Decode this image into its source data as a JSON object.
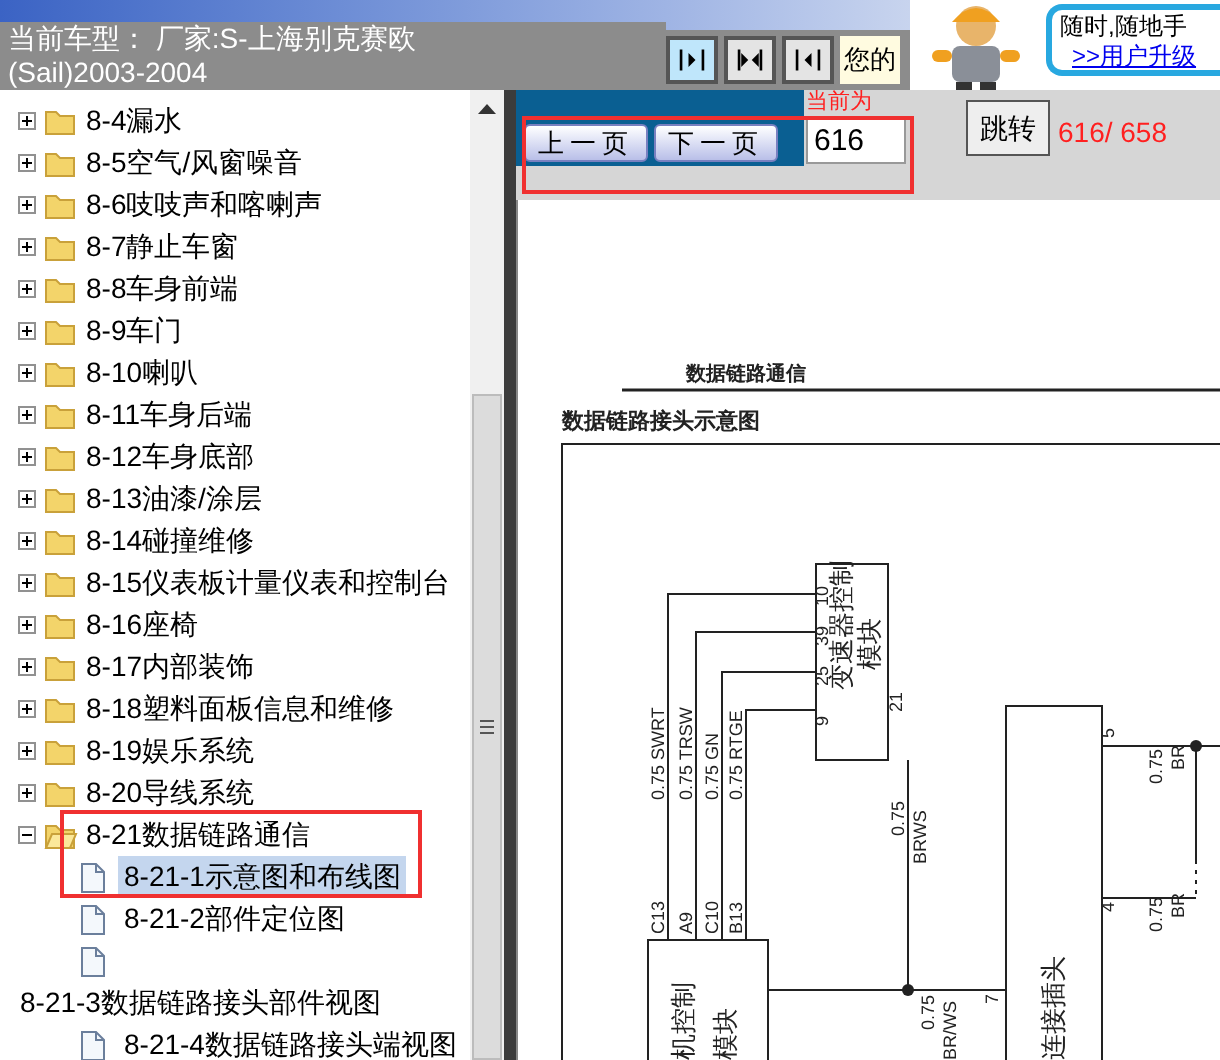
{
  "header": {
    "vehicle": "当前车型：  厂家:S-上海别克赛欧(Sail)2003-2004",
    "view_buttons": [
      {
        "kind": "right",
        "selected": true
      },
      {
        "kind": "both",
        "selected": false
      },
      {
        "kind": "left",
        "selected": false
      }
    ],
    "notice": "您的",
    "ad": {
      "text": "随时,随地手",
      "link": ">>用户升级"
    }
  },
  "tree": {
    "items": [
      {
        "label": "8-4漏水",
        "expanded": false
      },
      {
        "label": "8-5空气/风窗噪音",
        "expanded": false
      },
      {
        "label": "8-6吱吱声和喀喇声",
        "expanded": false
      },
      {
        "label": "8-7静止车窗",
        "expanded": false
      },
      {
        "label": "8-8车身前端",
        "expanded": false
      },
      {
        "label": "8-9车门",
        "expanded": false
      },
      {
        "label": "8-10喇叭",
        "expanded": false
      },
      {
        "label": "8-11车身后端",
        "expanded": false
      },
      {
        "label": "8-12车身底部",
        "expanded": false
      },
      {
        "label": "8-13油漆/涂层",
        "expanded": false
      },
      {
        "label": "8-14碰撞维修",
        "expanded": false
      },
      {
        "label": "8-15仪表板计量仪表和控制台",
        "expanded": false
      },
      {
        "label": "8-16座椅",
        "expanded": false
      },
      {
        "label": "8-17内部装饰",
        "expanded": false
      },
      {
        "label": "8-18塑料面板信息和维修",
        "expanded": false
      },
      {
        "label": "8-19娱乐系统",
        "expanded": false
      },
      {
        "label": "8-20导线系统",
        "expanded": false
      },
      {
        "label": "8-21数据链路通信",
        "expanded": true,
        "children": [
          {
            "kind": "doc",
            "label": "8-21-1示意图和布线图",
            "selected": true
          },
          {
            "kind": "doc",
            "label": "8-21-2部件定位图",
            "selected": false
          },
          {
            "kind": "doc",
            "selected": false
          },
          {
            "kind": "bare",
            "label": "8-21-3数据链路接头部件视图",
            "selected": false
          },
          {
            "kind": "doc",
            "label": "8-21-4数据链路接头端视图",
            "selected": false
          }
        ]
      }
    ]
  },
  "viewer": {
    "prev_button": "上一页",
    "next_button": "下一页",
    "page_label": "当前为",
    "page_input": "616",
    "jump_button": "跳转",
    "page_count": "616/ 658",
    "document": {
      "heading": "数据链路通信",
      "title": "数据链路接头示意图",
      "labels": [
        "变速器控制",
        "模块",
        "10",
        "39",
        "25",
        "9",
        "21",
        "0.75 SWRT",
        "0.75 TRSW",
        "0.75 GN",
        "0.75 RTGE",
        "C13",
        "A9",
        "C10",
        "B13",
        "机控制",
        "模块",
        "0.75",
        "BRWS",
        "0.75",
        "BR/WS",
        "7",
        "连接插头",
        "5",
        "4",
        "0.75",
        "BR",
        "0.75",
        "BR"
      ]
    }
  }
}
